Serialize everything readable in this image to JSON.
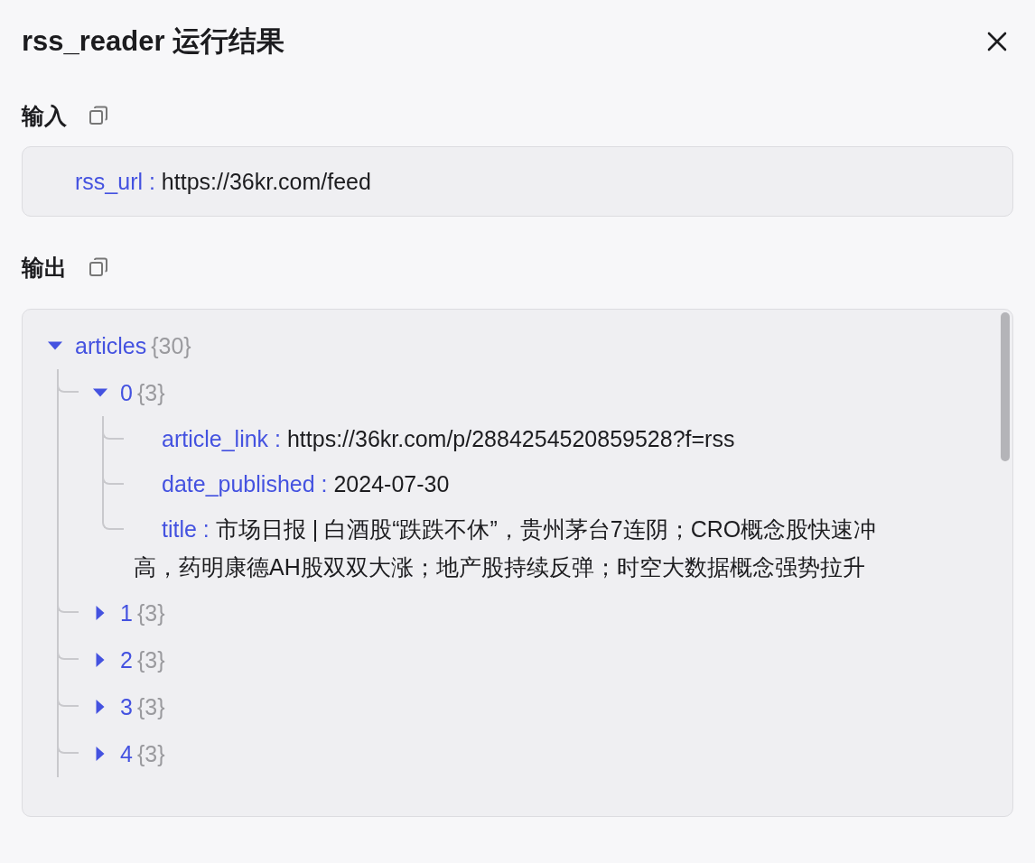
{
  "dialog": {
    "title": "rss_reader 运行结果"
  },
  "input": {
    "label": "输入",
    "fields": [
      {
        "key": "rss_url :",
        "value": "https://36kr.com/feed"
      }
    ]
  },
  "output": {
    "label": "输出",
    "tree": [
      {
        "kind": "node",
        "key": "articles",
        "count": "{30}",
        "expanded": true,
        "children": [
          {
            "kind": "node",
            "key": "0",
            "count": "{3}",
            "expanded": true,
            "children": [
              {
                "kind": "field",
                "key": "article_link :",
                "value": "https://36kr.com/p/2884254520859528?f=rss"
              },
              {
                "kind": "field",
                "key": "date_published :",
                "value": "2024-07-30"
              },
              {
                "kind": "field",
                "key": "title :",
                "value": "市场日报 | 白酒股“跌跌不休”，贵州茅台7连阴；CRO概念股快速冲高，药明康德AH股双双大涨；地产股持续反弹；时空大数据概念强势拉升"
              }
            ]
          },
          {
            "kind": "node",
            "key": "1",
            "count": "{3}",
            "expanded": false
          },
          {
            "kind": "node",
            "key": "2",
            "count": "{3}",
            "expanded": false
          },
          {
            "kind": "node",
            "key": "3",
            "count": "{3}",
            "expanded": false
          },
          {
            "kind": "node",
            "key": "4",
            "count": "{3}",
            "expanded": false
          }
        ]
      }
    ]
  }
}
